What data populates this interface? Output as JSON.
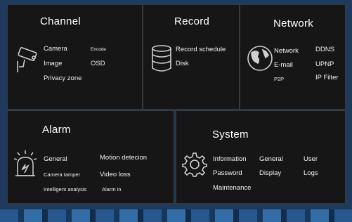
{
  "channel": {
    "title": "Channel",
    "items": [
      "Camera",
      "Encode",
      "Image",
      "OSD",
      "Privacy zone"
    ],
    "icon": "camera-icon"
  },
  "record": {
    "title": "Record",
    "items": [
      "Record schedule",
      "Disk"
    ],
    "icon": "database-icon"
  },
  "network": {
    "title": "Network",
    "items": [
      "Network",
      "DDNS",
      "E-mail",
      "UPNP",
      "P2P",
      "IP Filter"
    ],
    "icon": "globe-icon"
  },
  "alarm": {
    "title": "Alarm",
    "items": [
      "General",
      "Motion detecion",
      "Camera tamper",
      "Video loss",
      "Intelligent analysis",
      "Alarm in"
    ],
    "icon": "alarm-icon"
  },
  "system": {
    "title": "System",
    "items": [
      "Information",
      "General",
      "User",
      "Password",
      "Display",
      "Logs",
      "Maintenance"
    ],
    "icon": "gear-icon"
  },
  "colors": {
    "panel": "#161616",
    "text": "#ffffff",
    "background": "#1e3a5c"
  }
}
